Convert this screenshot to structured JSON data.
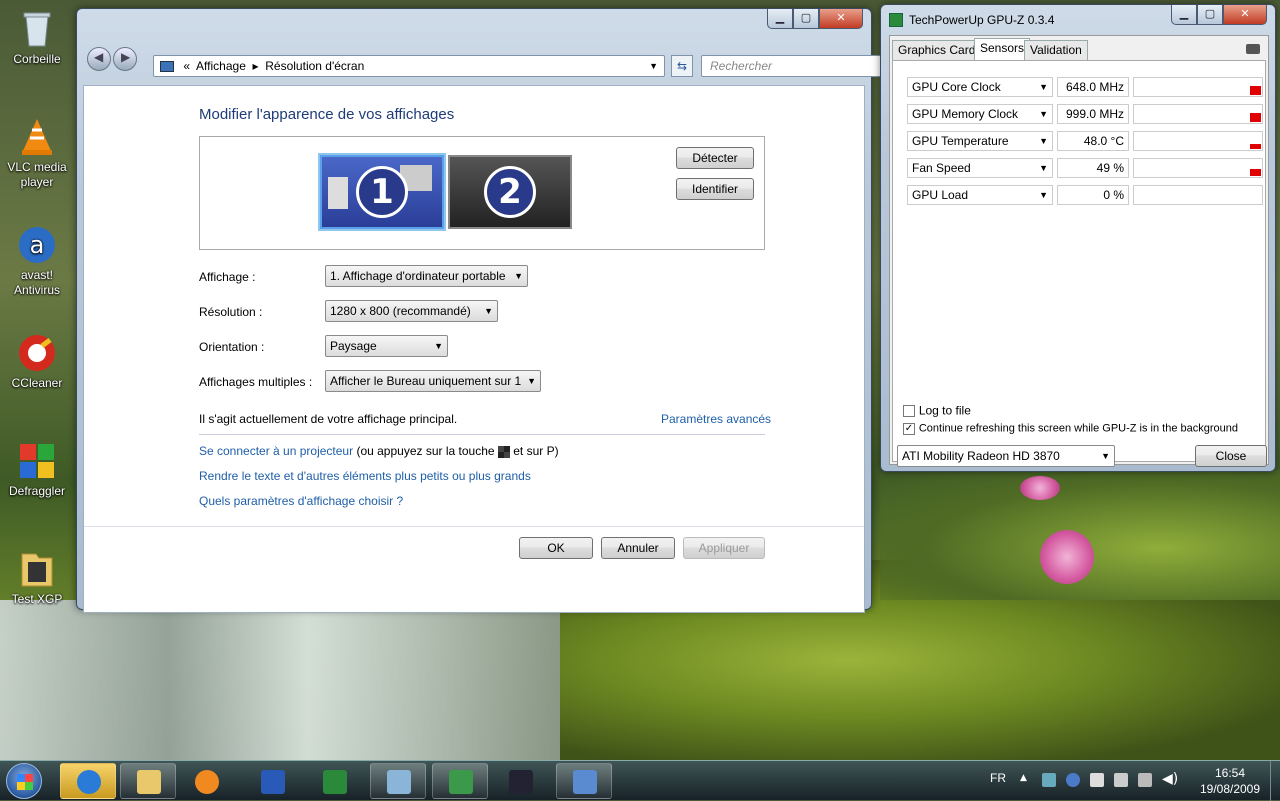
{
  "desktop": {
    "icons": [
      {
        "label": "Corbeille"
      },
      {
        "label": "VLC media player"
      },
      {
        "label": "avast! Antivirus"
      },
      {
        "label": "CCleaner"
      },
      {
        "label": "Defraggler"
      },
      {
        "label": "Test XGP"
      }
    ]
  },
  "control_panel": {
    "breadcrumb": {
      "prefix": "«",
      "item1": "Affichage",
      "sep": "▸",
      "item2": "Résolution d'écran"
    },
    "search_placeholder": "Rechercher",
    "heading": "Modifier l'apparence de vos affichages",
    "monitors": [
      "1",
      "2"
    ],
    "detect_button": "Détecter",
    "identify_button": "Identifier",
    "display_label": "Affichage :",
    "display_value": "1. Affichage d'ordinateur portable",
    "resolution_label": "Résolution :",
    "resolution_value": "1280 x 800 (recommandé)",
    "orientation_label": "Orientation :",
    "orientation_value": "Paysage",
    "multiple_label": "Affichages multiples :",
    "multiple_value": "Afficher le Bureau uniquement sur 1",
    "primary_text": "Il s'agit actuellement de votre affichage principal.",
    "advanced_link": "Paramètres avancés",
    "projector_link": "Se connecter à un projecteur",
    "projector_text_a": "(ou appuyez sur la touche",
    "projector_text_b": "et sur P)",
    "text_size_link": "Rendre le texte et d'autres éléments plus petits ou plus grands",
    "which_settings_link": "Quels paramètres d'affichage choisir ?",
    "ok": "OK",
    "cancel": "Annuler",
    "apply": "Appliquer"
  },
  "gpuz": {
    "title": "TechPowerUp GPU-Z 0.3.4",
    "tabs": [
      "Graphics Card",
      "Sensors",
      "Validation"
    ],
    "active_tab": "Sensors",
    "sensors": [
      {
        "name": "GPU Core Clock",
        "value": "648.0 MHz",
        "level": 0.5
      },
      {
        "name": "GPU Memory Clock",
        "value": "999.0 MHz",
        "level": 0.5
      },
      {
        "name": "GPU Temperature",
        "value": "48.0 °C",
        "level": 0.25
      },
      {
        "name": "Fan Speed",
        "value": "49 %",
        "level": 0.4
      },
      {
        "name": "GPU Load",
        "value": "0 %",
        "level": 0
      }
    ],
    "log_to_file": "Log to file",
    "log_checked": false,
    "continue_refresh": "Continue refreshing this screen while GPU-Z is in the background",
    "continue_checked": true,
    "card_select": "ATI Mobility Radeon HD 3870",
    "close": "Close"
  },
  "taskbar": {
    "lang": "FR",
    "time": "16:54",
    "date": "19/08/2009"
  },
  "colors": {
    "link": "#1f5fa8",
    "heading": "#1e3c78",
    "sensor_bar": "#e00000"
  }
}
